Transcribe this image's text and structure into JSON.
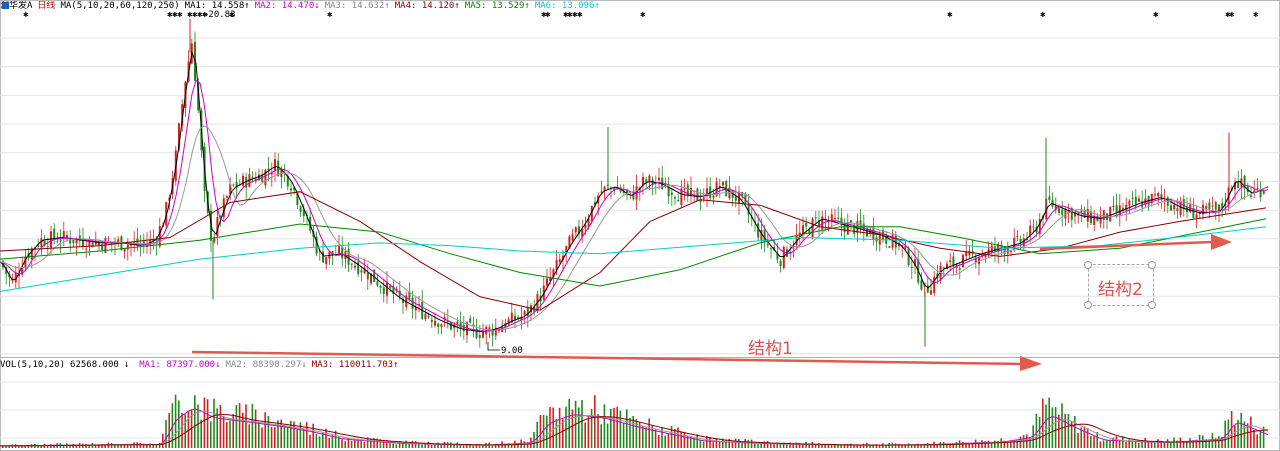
{
  "header": {
    "stock_name": "深华发A",
    "period": "日线",
    "ma_label": "MA(5,10,20,60,120,250)",
    "ma_values": [
      {
        "label": "MA1:",
        "value": "14.558",
        "arrow": "↑",
        "color": "#000000"
      },
      {
        "label": "MA2:",
        "value": "14.470",
        "arrow": "↓",
        "color": "#cc00cc"
      },
      {
        "label": "MA3:",
        "value": "14.632",
        "arrow": "↑",
        "color": "#888888"
      },
      {
        "label": "MA4:",
        "value": "14.120",
        "arrow": "↑",
        "color": "#880000"
      },
      {
        "label": "MA5:",
        "value": "13.529",
        "arrow": "↑",
        "color": "#008800"
      },
      {
        "label": "MA6:",
        "value": "13.096",
        "arrow": "↑",
        "color": "#00cccc"
      }
    ]
  },
  "vol_header": {
    "label": "VOL(5,10,20)",
    "vol_value": "62568.000",
    "vol_arrow": "↓",
    "ma_values": [
      {
        "label": "MA1:",
        "value": "87397.000",
        "arrow": "↓",
        "color": "#cc00cc"
      },
      {
        "label": "MA2:",
        "value": "88390.297",
        "arrow": "↓",
        "color": "#888888"
      },
      {
        "label": "MA3:",
        "value": "110011.703",
        "arrow": "↑",
        "color": "#880000"
      }
    ]
  },
  "annotations": {
    "high_label": "20.83",
    "low_label": "9.00",
    "structure1": "结构1",
    "structure2": "结构2",
    "arrow_color": "#e05a4e"
  },
  "chart_data": [
    {
      "type": "candlestick",
      "title": "深华发A 日线",
      "ylim": [
        8.3,
        21.0
      ],
      "price_path": [
        {
          "x": 0,
          "y": 11.8
        },
        {
          "x": 12,
          "y": 11.0
        },
        {
          "x": 25,
          "y": 12.0
        },
        {
          "x": 40,
          "y": 12.6
        },
        {
          "x": 60,
          "y": 12.7
        },
        {
          "x": 80,
          "y": 12.6
        },
        {
          "x": 100,
          "y": 12.5
        },
        {
          "x": 120,
          "y": 12.5
        },
        {
          "x": 140,
          "y": 12.4
        },
        {
          "x": 155,
          "y": 12.6
        },
        {
          "x": 165,
          "y": 13.5
        },
        {
          "x": 175,
          "y": 15.5
        },
        {
          "x": 185,
          "y": 18.5
        },
        {
          "x": 192,
          "y": 20.0
        },
        {
          "x": 198,
          "y": 17.5
        },
        {
          "x": 205,
          "y": 14.0
        },
        {
          "x": 212,
          "y": 12.6
        },
        {
          "x": 220,
          "y": 13.5
        },
        {
          "x": 230,
          "y": 14.5
        },
        {
          "x": 245,
          "y": 14.8
        },
        {
          "x": 260,
          "y": 15.0
        },
        {
          "x": 275,
          "y": 15.4
        },
        {
          "x": 290,
          "y": 14.8
        },
        {
          "x": 305,
          "y": 13.5
        },
        {
          "x": 320,
          "y": 12.0
        },
        {
          "x": 340,
          "y": 12.1
        },
        {
          "x": 360,
          "y": 11.6
        },
        {
          "x": 380,
          "y": 11.0
        },
        {
          "x": 400,
          "y": 10.4
        },
        {
          "x": 420,
          "y": 10.0
        },
        {
          "x": 440,
          "y": 9.6
        },
        {
          "x": 460,
          "y": 9.3
        },
        {
          "x": 480,
          "y": 9.2
        },
        {
          "x": 495,
          "y": 9.3
        },
        {
          "x": 510,
          "y": 9.6
        },
        {
          "x": 525,
          "y": 9.8
        },
        {
          "x": 540,
          "y": 10.5
        },
        {
          "x": 555,
          "y": 11.5
        },
        {
          "x": 570,
          "y": 12.5
        },
        {
          "x": 585,
          "y": 13.3
        },
        {
          "x": 600,
          "y": 14.4
        },
        {
          "x": 615,
          "y": 14.6
        },
        {
          "x": 630,
          "y": 14.2
        },
        {
          "x": 645,
          "y": 14.8
        },
        {
          "x": 660,
          "y": 14.7
        },
        {
          "x": 680,
          "y": 14.3
        },
        {
          "x": 700,
          "y": 14.2
        },
        {
          "x": 720,
          "y": 14.6
        },
        {
          "x": 740,
          "y": 14.1
        },
        {
          "x": 760,
          "y": 12.8
        },
        {
          "x": 780,
          "y": 11.9
        },
        {
          "x": 800,
          "y": 12.8
        },
        {
          "x": 820,
          "y": 13.4
        },
        {
          "x": 840,
          "y": 13.2
        },
        {
          "x": 860,
          "y": 13.0
        },
        {
          "x": 880,
          "y": 12.8
        },
        {
          "x": 900,
          "y": 12.4
        },
        {
          "x": 915,
          "y": 11.6
        },
        {
          "x": 925,
          "y": 10.7
        },
        {
          "x": 940,
          "y": 11.5
        },
        {
          "x": 960,
          "y": 11.8
        },
        {
          "x": 980,
          "y": 12.1
        },
        {
          "x": 1000,
          "y": 12.3
        },
        {
          "x": 1020,
          "y": 12.5
        },
        {
          "x": 1035,
          "y": 13.0
        },
        {
          "x": 1048,
          "y": 14.0
        },
        {
          "x": 1060,
          "y": 13.8
        },
        {
          "x": 1080,
          "y": 13.5
        },
        {
          "x": 1100,
          "y": 13.4
        },
        {
          "x": 1120,
          "y": 13.7
        },
        {
          "x": 1140,
          "y": 14.0
        },
        {
          "x": 1160,
          "y": 14.2
        },
        {
          "x": 1180,
          "y": 13.8
        },
        {
          "x": 1200,
          "y": 13.6
        },
        {
          "x": 1220,
          "y": 13.7
        },
        {
          "x": 1235,
          "y": 14.9
        },
        {
          "x": 1250,
          "y": 14.3
        },
        {
          "x": 1266,
          "y": 14.6
        }
      ],
      "ma_series": [
        {
          "color": "#880000",
          "points": [
            {
              "x": 0,
              "y": 12.2
            },
            {
              "x": 100,
              "y": 12.4
            },
            {
              "x": 170,
              "y": 12.7
            },
            {
              "x": 230,
              "y": 14.0
            },
            {
              "x": 300,
              "y": 14.4
            },
            {
              "x": 360,
              "y": 13.3
            },
            {
              "x": 420,
              "y": 11.8
            },
            {
              "x": 480,
              "y": 10.5
            },
            {
              "x": 540,
              "y": 10.0
            },
            {
              "x": 600,
              "y": 11.4
            },
            {
              "x": 650,
              "y": 13.3
            },
            {
              "x": 700,
              "y": 14.1
            },
            {
              "x": 760,
              "y": 13.9
            },
            {
              "x": 820,
              "y": 13.1
            },
            {
              "x": 880,
              "y": 12.8
            },
            {
              "x": 940,
              "y": 12.3
            },
            {
              "x": 1000,
              "y": 12.0
            },
            {
              "x": 1060,
              "y": 12.3
            },
            {
              "x": 1120,
              "y": 12.9
            },
            {
              "x": 1180,
              "y": 13.3
            },
            {
              "x": 1266,
              "y": 13.8
            }
          ]
        },
        {
          "color": "#008800",
          "points": [
            {
              "x": 0,
              "y": 11.9
            },
            {
              "x": 100,
              "y": 12.2
            },
            {
              "x": 200,
              "y": 12.6
            },
            {
              "x": 300,
              "y": 13.2
            },
            {
              "x": 380,
              "y": 12.9
            },
            {
              "x": 450,
              "y": 12.1
            },
            {
              "x": 520,
              "y": 11.4
            },
            {
              "x": 600,
              "y": 10.9
            },
            {
              "x": 680,
              "y": 11.5
            },
            {
              "x": 760,
              "y": 12.5
            },
            {
              "x": 840,
              "y": 13.1
            },
            {
              "x": 900,
              "y": 13.1
            },
            {
              "x": 960,
              "y": 12.7
            },
            {
              "x": 1040,
              "y": 12.1
            },
            {
              "x": 1120,
              "y": 12.3
            },
            {
              "x": 1200,
              "y": 12.9
            },
            {
              "x": 1266,
              "y": 13.4
            }
          ]
        },
        {
          "color": "#00cccc",
          "points": [
            {
              "x": 0,
              "y": 10.7
            },
            {
              "x": 100,
              "y": 11.3
            },
            {
              "x": 200,
              "y": 11.9
            },
            {
              "x": 300,
              "y": 12.3
            },
            {
              "x": 380,
              "y": 12.5
            },
            {
              "x": 450,
              "y": 12.4
            },
            {
              "x": 520,
              "y": 12.2
            },
            {
              "x": 600,
              "y": 12.1
            },
            {
              "x": 700,
              "y": 12.4
            },
            {
              "x": 800,
              "y": 12.7
            },
            {
              "x": 900,
              "y": 12.6
            },
            {
              "x": 1000,
              "y": 12.3
            },
            {
              "x": 1100,
              "y": 12.4
            },
            {
              "x": 1200,
              "y": 12.8
            },
            {
              "x": 1266,
              "y": 13.1
            }
          ]
        }
      ]
    },
    {
      "type": "bar",
      "title": "VOL(5,10,20)",
      "ylim": [
        0,
        300000
      ],
      "volume_path": [
        {
          "x": 0,
          "y": 12000
        },
        {
          "x": 100,
          "y": 18000
        },
        {
          "x": 160,
          "y": 20000
        },
        {
          "x": 170,
          "y": 150000
        },
        {
          "x": 190,
          "y": 230000
        },
        {
          "x": 210,
          "y": 170000
        },
        {
          "x": 240,
          "y": 150000
        },
        {
          "x": 280,
          "y": 120000
        },
        {
          "x": 310,
          "y": 90000
        },
        {
          "x": 340,
          "y": 50000
        },
        {
          "x": 400,
          "y": 25000
        },
        {
          "x": 480,
          "y": 15000
        },
        {
          "x": 530,
          "y": 30000
        },
        {
          "x": 545,
          "y": 140000
        },
        {
          "x": 570,
          "y": 190000
        },
        {
          "x": 600,
          "y": 170000
        },
        {
          "x": 640,
          "y": 110000
        },
        {
          "x": 700,
          "y": 40000
        },
        {
          "x": 760,
          "y": 25000
        },
        {
          "x": 840,
          "y": 16000
        },
        {
          "x": 920,
          "y": 18000
        },
        {
          "x": 1000,
          "y": 35000
        },
        {
          "x": 1030,
          "y": 60000
        },
        {
          "x": 1046,
          "y": 190000
        },
        {
          "x": 1070,
          "y": 120000
        },
        {
          "x": 1100,
          "y": 45000
        },
        {
          "x": 1160,
          "y": 30000
        },
        {
          "x": 1220,
          "y": 50000
        },
        {
          "x": 1232,
          "y": 150000
        },
        {
          "x": 1266,
          "y": 70000
        }
      ]
    }
  ]
}
